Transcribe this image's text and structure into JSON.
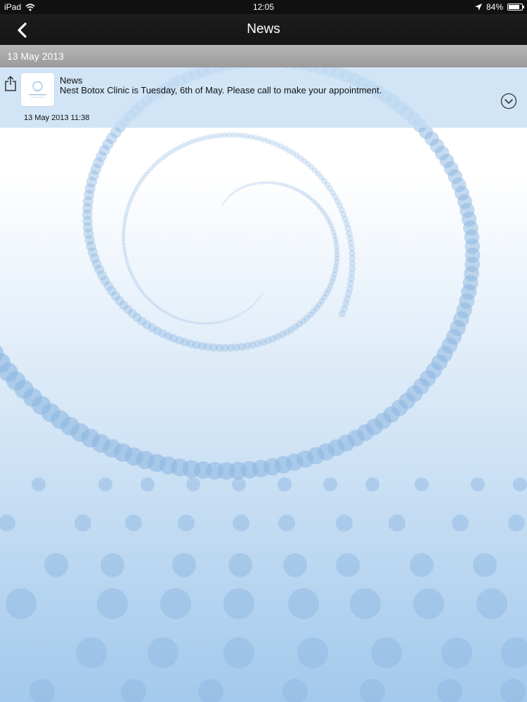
{
  "status_bar": {
    "device": "iPad",
    "time": "12:05",
    "battery_percent_label": "84%",
    "battery_level": 0.84,
    "wifi_icon": "wifi-icon",
    "location_icon": "location-arrow-icon"
  },
  "nav": {
    "title": "News",
    "back_icon": "chevron-left-icon"
  },
  "date_header": {
    "label": "13 May 2013"
  },
  "news_items": [
    {
      "title": "News",
      "body": "Nest Botox Clinic is Tuesday, 6th of May. Please call to make your appointment.",
      "timestamp": "13 May 2013 11:38",
      "share_icon": "share-icon",
      "expand_icon": "chevron-down-circle-icon"
    }
  ],
  "colors": {
    "status_bar": "#111111",
    "nav_bar": "#1a1a1a",
    "date_header": "#a8a8a8",
    "item_background": "#c4def3",
    "background_top": "#ffffff",
    "background_bottom": "#a3c9ec",
    "dot_color": "#8cb6e0"
  }
}
